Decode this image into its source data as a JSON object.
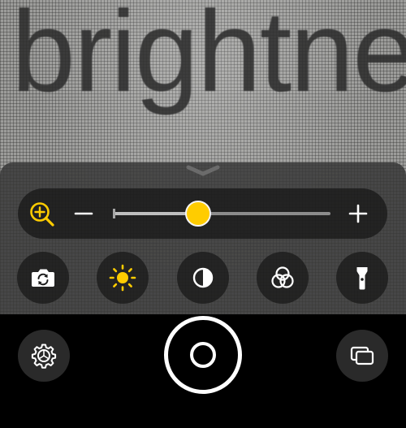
{
  "camera_feed": {
    "text": "brightnes"
  },
  "zoom": {
    "level_fraction": 0.39,
    "icons": {
      "zoom": "zoom-in-magnifier-icon",
      "minus": "minus-icon",
      "plus": "plus-icon"
    }
  },
  "tools": [
    {
      "name": "flip-camera",
      "icon": "camera-flip-icon",
      "active": false
    },
    {
      "name": "brightness",
      "icon": "sun-icon",
      "active": true
    },
    {
      "name": "contrast",
      "icon": "contrast-icon",
      "active": false
    },
    {
      "name": "filters",
      "icon": "color-filters-icon",
      "active": false
    },
    {
      "name": "flashlight",
      "icon": "flashlight-icon",
      "active": false
    }
  ],
  "bottom_bar": {
    "left_icon": "settings-gear-icon",
    "center": "shutter-button",
    "right_icon": "multi-image-icon"
  },
  "colors": {
    "accent": "#ffcc00",
    "icon_white": "#ffffff",
    "panel": "#343434"
  }
}
